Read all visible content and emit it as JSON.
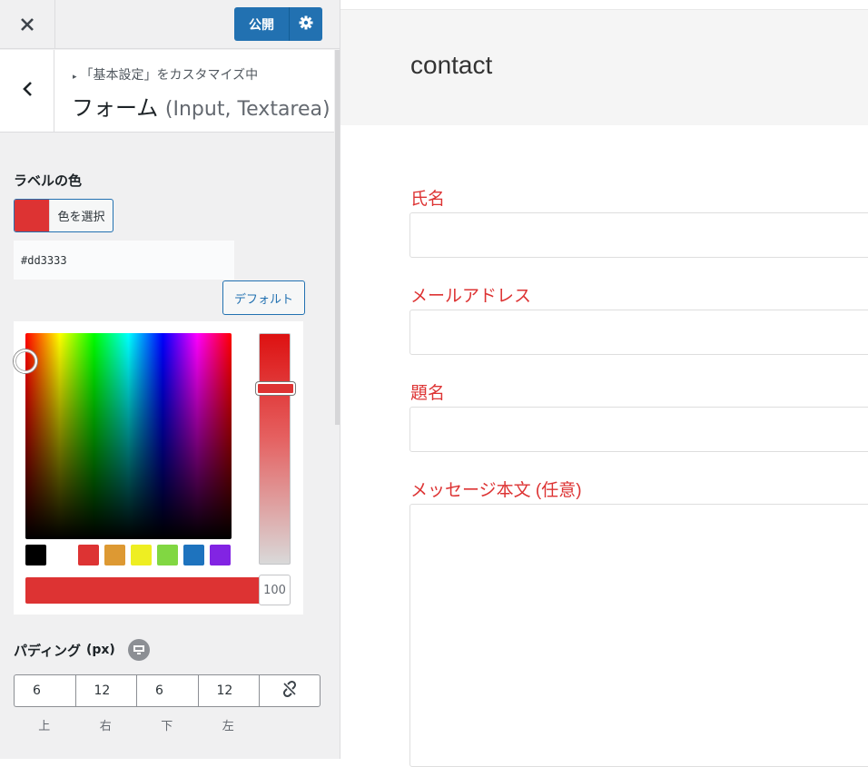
{
  "topbar": {
    "close_icon": "×",
    "publish_label": "公開",
    "settings_icon": "gear-icon"
  },
  "section": {
    "breadcrumb": "「基本設定」をカスタマイズ中",
    "title_main": "フォーム",
    "title_sub": "(Input, Textarea)"
  },
  "label_color": {
    "title": "ラベルの色",
    "select_label": "色を選択",
    "hex_value": "#dd3333",
    "default_label": "デフォルト",
    "swatch_color": "#dd3333",
    "palette": [
      "#000000",
      "#ffffff",
      "#dd3333",
      "#dd9933",
      "#eeee22",
      "#81d742",
      "#1e73be",
      "#8224e3"
    ],
    "alpha_value": "100"
  },
  "padding": {
    "title": "パディング",
    "unit": "(px)",
    "values": [
      "6",
      "12",
      "6",
      "12"
    ],
    "labels": [
      "上",
      "右",
      "下",
      "左"
    ]
  },
  "preview": {
    "page_title": "contact",
    "fields": [
      {
        "label": "氏名"
      },
      {
        "label": "メールアドレス"
      },
      {
        "label": "題名"
      },
      {
        "label": "メッセージ本文 (任意)"
      }
    ],
    "label_color": "#dd3333"
  }
}
